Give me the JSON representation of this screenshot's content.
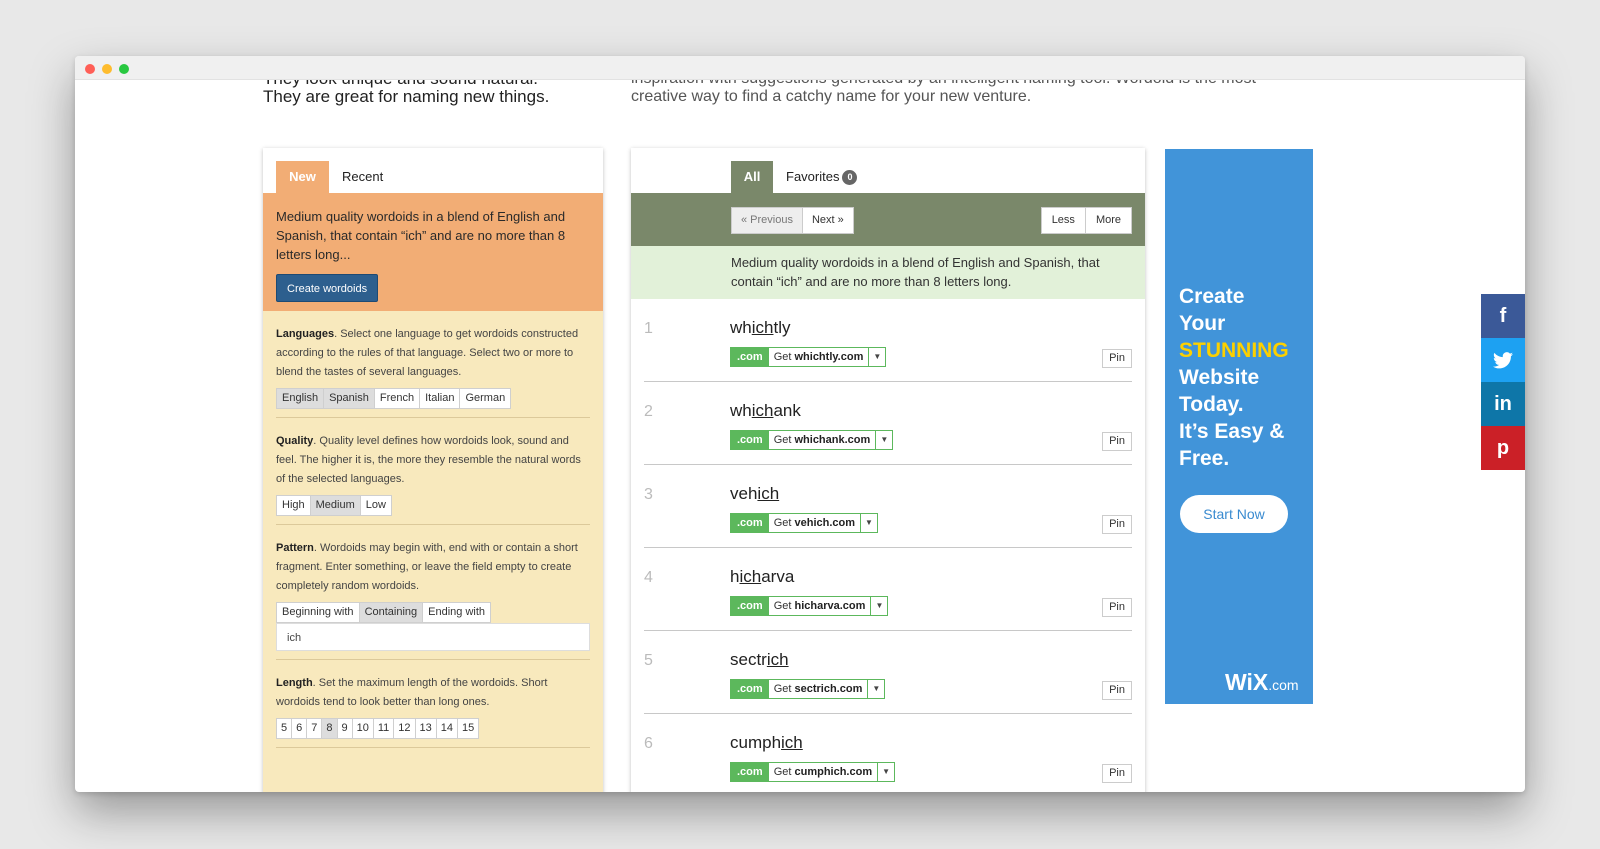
{
  "intro": {
    "left_line1": "They look unique and sound natural.",
    "left_line2": "They are great for naming new things.",
    "right_line1": "inspiration with suggestions generated by an intelligent naming tool. Wordoid is the most",
    "right_line2": "creative way to find a catchy name for your new venture."
  },
  "left": {
    "tabs": [
      "New",
      "Recent"
    ],
    "summary": "Medium quality wordoids in a blend of English and Spanish, that contain “ich” and are no more than 8 letters long...",
    "create_label": "Create wordoids",
    "languages": {
      "title": "Languages",
      "desc": ". Select one language to get wordoids constructed according to the rules of that language. Select two or more to blend the tastes of several languages.",
      "options": [
        "English",
        "Spanish",
        "French",
        "Italian",
        "German"
      ]
    },
    "quality": {
      "title": "Quality",
      "desc": ". Quality level defines how wordoids look, sound and feel. The higher it is, the more they resemble the natural words of the selected languages.",
      "options": [
        "High",
        "Medium",
        "Low"
      ]
    },
    "pattern": {
      "title": "Pattern",
      "desc": ". Wordoids may begin with, end with or contain a short fragment. Enter something, or leave the field empty to create completely random wordoids.",
      "options": [
        "Beginning with",
        "Containing",
        "Ending with"
      ],
      "value": "ich"
    },
    "length": {
      "title": "Length",
      "desc": ". Set the maximum length of the wordoids. Short wordoids tend to look better than long ones.",
      "options": [
        "5",
        "6",
        "7",
        "8",
        "9",
        "10",
        "11",
        "12",
        "13",
        "14",
        "15"
      ]
    }
  },
  "middle": {
    "tab_all": "All",
    "tab_favorites": "Favorites",
    "favorites_count": "0",
    "prev": "« Previous",
    "next": "Next »",
    "less": "Less",
    "more": "More",
    "description": "Medium quality wordoids in a blend of English and Spanish, that contain “ich” and are no more than 8 letters long.",
    "tld": ".com",
    "get": "Get",
    "pin": "Pin",
    "words": [
      {
        "num": "1",
        "pre": "wh",
        "mid": "ich",
        "post": "tly",
        "domain": "whichtly.com"
      },
      {
        "num": "2",
        "pre": "wh",
        "mid": "ich",
        "post": "ank",
        "domain": "whichank.com"
      },
      {
        "num": "3",
        "pre": "veh",
        "mid": "ich",
        "post": "",
        "domain": "vehich.com"
      },
      {
        "num": "4",
        "pre": "h",
        "mid": "ich",
        "post": "arva",
        "domain": "hicharva.com"
      },
      {
        "num": "5",
        "pre": "sectr",
        "mid": "ich",
        "post": "",
        "domain": "sectrich.com"
      },
      {
        "num": "6",
        "pre": "cumph",
        "mid": "ich",
        "post": "",
        "domain": "cumphich.com"
      }
    ]
  },
  "ad": {
    "line1": "Create",
    "line2": "Your",
    "line3": "STUNNING",
    "line4": "Website",
    "line5": "Today.",
    "line6": "It’s Easy &",
    "line7": "Free.",
    "button": "Start Now",
    "logo": "WiX",
    "logo_suffix": ".com"
  },
  "social": {
    "facebook": "f",
    "twitter": "t",
    "linkedin": "in",
    "pinterest": "p"
  }
}
